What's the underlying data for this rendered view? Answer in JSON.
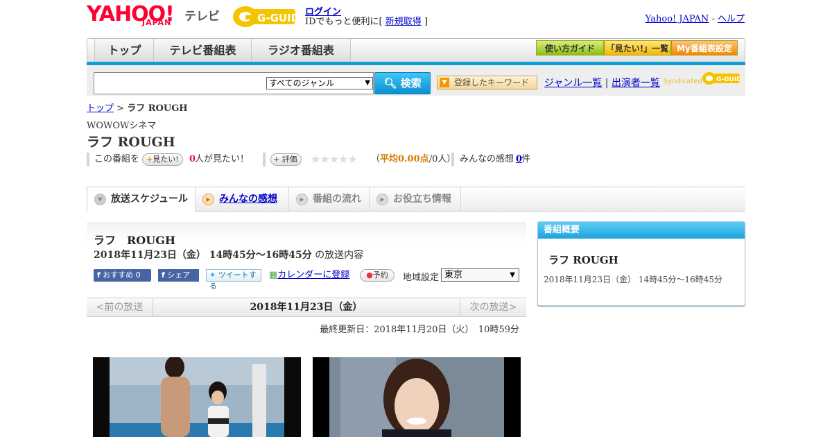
{
  "header": {
    "yahoo_logo": "YAHOO!",
    "yahoo_logo_sub": "JAPAN",
    "tv_label": "テレビ",
    "gguide_logo": "G-GUIDE",
    "login_link": "ログイン",
    "login_sub_prefix": "IDでもっと便利に[",
    "register_link": "新規取得",
    "login_sub_suffix": "]",
    "yahoo_japan_link": "Yahoo! JAPAN",
    "separator": "-",
    "help_link": "ヘルプ"
  },
  "nav": {
    "tabs": [
      "トップ",
      "テレビ番組表",
      "ラジオ番組表"
    ],
    "guide_button": "使い方ガイド",
    "mitai_button": "「見たい!」一覧",
    "my_button": "My番組表設定"
  },
  "search": {
    "input_value": "",
    "genre_selected": "すべてのジャンル",
    "search_button": "検索",
    "keyword_button": "登録したキーワード",
    "genre_list_link": "ジャンル一覧",
    "link_separator": "|",
    "performer_list_link": "出演者一覧",
    "syndicated": "Syndicated"
  },
  "breadcrumb": {
    "top_link": "トップ",
    "separator": ">",
    "current": "ラフ ROUGH"
  },
  "program": {
    "channel": "WOWOWシネマ",
    "title": "ラフ ROUGH",
    "want_prefix": "この番組を",
    "want_button": "見たい!",
    "want_count": "0",
    "want_suffix": "人が見たい！",
    "rate_button": "評価",
    "stars": "★★★★★",
    "rating_open": "（",
    "rating_avg": "平均0.00点",
    "rating_people": "/0人",
    "rating_close": "）",
    "impressions_label": "みんなの感想",
    "impressions_count": "0",
    "impressions_suffix": "件"
  },
  "tabs": [
    {
      "label": "放送スケジュール",
      "active": true
    },
    {
      "label": "みんなの感想",
      "link": true
    },
    {
      "label": "番組の流れ",
      "disabled": true
    },
    {
      "label": "お役立ち情報",
      "disabled": true
    }
  ],
  "broadcast": {
    "title": "ラフ　ROUGH",
    "datetime": "2018年11月23日（金）  14時45分～16時45分",
    "datetime_suffix": "の放送内容",
    "recommend_label": "おすすめ",
    "recommend_count": "0",
    "share_label": "シェア",
    "tweet_label": "ツイートする",
    "calendar_link": "カレンダーに登録",
    "reserve_label": "予約",
    "region_label": "地域設定",
    "region_value": "東京"
  },
  "date_nav": {
    "prev": "<前の放送",
    "current": "2018年11月23日（金）",
    "next": "次の放送>"
  },
  "updated": "最終更新日：2018年11月20日（火）　10時59分",
  "sidebar": {
    "heading": "番組概要",
    "title": "ラフ ROUGH",
    "time": "2018年11月23日（金）  14時45分～16時45分"
  },
  "colors": {
    "accent_blue": "#0d9fd8",
    "yahoo_red": "#ff0033",
    "gguide_yellow": "#f5c400",
    "link": "#0000cc"
  }
}
